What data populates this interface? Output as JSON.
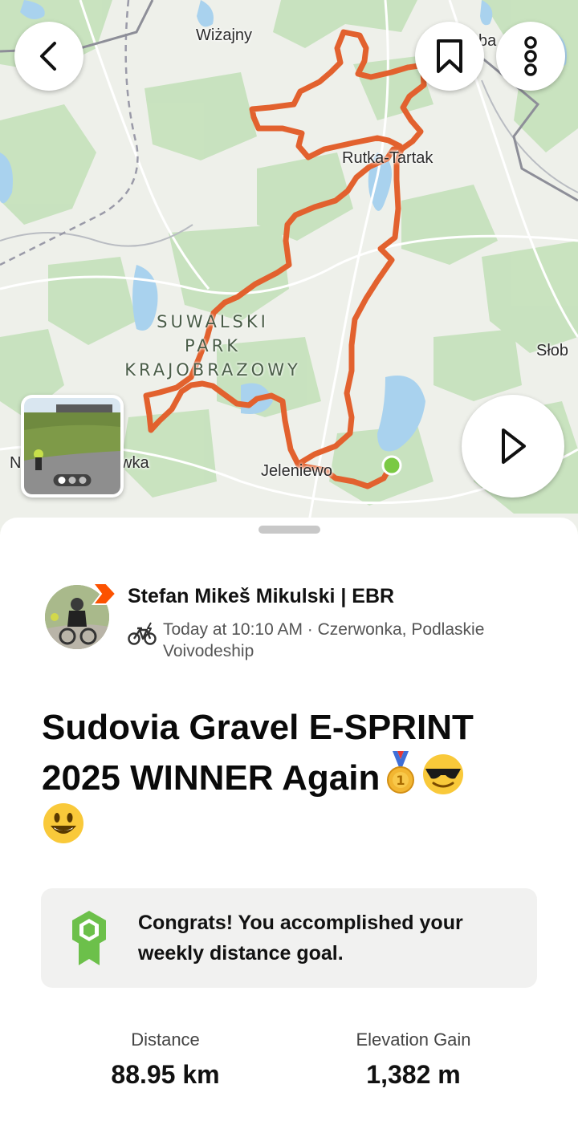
{
  "map": {
    "places": {
      "wizajny": "Wiżajny",
      "rutka": "Rutka-Tartak",
      "jeleniewo": "Jeleniewo",
      "slob": "Słob",
      "ba": "ba",
      "n": "N",
      "wka": "wka"
    },
    "park_lines": [
      "SUWALSKI",
      "PARK",
      "KRAJOBRAZOWY"
    ],
    "route_color": "#e2612e",
    "start_color": "#7ac943",
    "photo_count": 3
  },
  "buttons": {
    "back": "back",
    "bookmark": "bookmark",
    "more": "more",
    "play": "play"
  },
  "athlete": {
    "name": "Stefan  Mikeš Mikulski | EBR",
    "meta": "Today at 10:10 AM · Czerwonka, Podlaskie Voivodeship",
    "activity_icon": "bike-icon"
  },
  "activity": {
    "title": "Sudovia Gravel E-SPRINT 2025 WINNER Again",
    "emojis": [
      "medal",
      "sunglasses",
      "smiley"
    ]
  },
  "goal": {
    "text": "Congrats! You accomplished your weekly distance goal."
  },
  "stats": [
    {
      "label": "Distance",
      "value": "88.95 km"
    },
    {
      "label": "Elevation Gain",
      "value": "1,382 m"
    }
  ],
  "colors": {
    "accent": "#fc5200",
    "goal_green": "#6cc04a"
  }
}
